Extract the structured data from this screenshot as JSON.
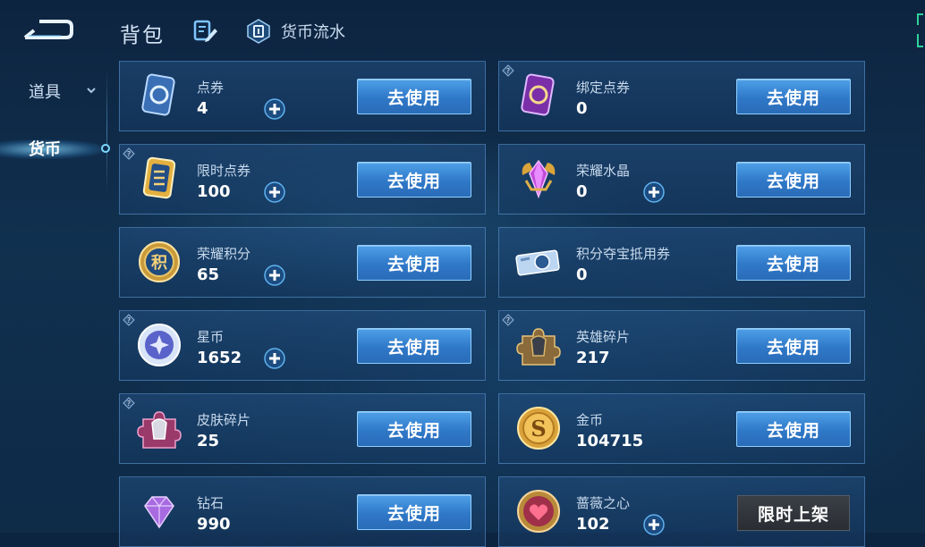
{
  "header": {
    "title": "背包",
    "flow_label": "货币流水"
  },
  "sidebar": {
    "items": [
      {
        "label": "道具"
      },
      {
        "label": "货币"
      }
    ]
  },
  "colors": {
    "accent": "#3f8fdc",
    "button_border": "#8fd0ff",
    "background": "#0f2a46"
  },
  "cards": [
    {
      "name": "点券",
      "count": "4",
      "button": "去使用",
      "icon": "ticket-icon"
    },
    {
      "name": "绑定点券",
      "count": "0",
      "button": "去使用",
      "icon": "bound-ticket-icon"
    },
    {
      "name": "限时点券",
      "count": "100",
      "button": "去使用",
      "icon": "limited-ticket-icon"
    },
    {
      "name": "荣耀水晶",
      "count": "0",
      "button": "去使用",
      "icon": "glory-crystal-icon"
    },
    {
      "name": "荣耀积分",
      "count": "65",
      "button": "去使用",
      "icon": "glory-points-icon"
    },
    {
      "name": "积分夺宝抵用券",
      "count": "0",
      "button": "去使用",
      "icon": "voucher-icon"
    },
    {
      "name": "星币",
      "count": "1652",
      "button": "去使用",
      "icon": "star-coin-icon"
    },
    {
      "name": "英雄碎片",
      "count": "217",
      "button": "去使用",
      "icon": "hero-fragment-icon"
    },
    {
      "name": "皮肤碎片",
      "count": "25",
      "button": "去使用",
      "icon": "skin-fragment-icon"
    },
    {
      "name": "金币",
      "count": "104715",
      "button": "去使用",
      "icon": "gold-coin-icon"
    },
    {
      "name": "钻石",
      "count": "990",
      "button": "去使用",
      "icon": "diamond-icon"
    },
    {
      "name": "蔷薇之心",
      "count": "102",
      "button": "限时上架",
      "icon": "rose-heart-icon"
    }
  ]
}
